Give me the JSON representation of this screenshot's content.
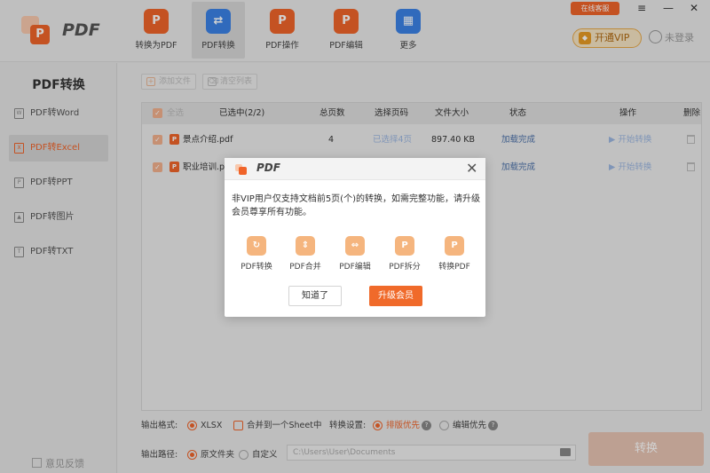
{
  "app": {
    "title": "PDF"
  },
  "toolbar": {
    "tabs": [
      {
        "label": "转换为PDF",
        "icon": "convert-to-pdf-icon"
      },
      {
        "label": "PDF转换",
        "icon": "pdf-convert-icon"
      },
      {
        "label": "PDF操作",
        "icon": "pdf-operate-icon"
      },
      {
        "label": "PDF编辑",
        "icon": "pdf-edit-icon"
      },
      {
        "label": "更多",
        "icon": "more-grid-icon"
      }
    ],
    "service_label": "在线客服",
    "vip_label": "开通VIP",
    "login_label": "未登录"
  },
  "sidebar": {
    "title": "PDF转换",
    "items": [
      {
        "label": "PDF转Word",
        "icon": "W"
      },
      {
        "label": "PDF转Excel",
        "icon": "X"
      },
      {
        "label": "PDF转PPT",
        "icon": "P"
      },
      {
        "label": "PDF转图片",
        "icon": "▲"
      },
      {
        "label": "PDF转TXT",
        "icon": "T"
      }
    ],
    "feedback_label": "意见反馈"
  },
  "main": {
    "add_file_label": "添加文件",
    "clear_list_label": "清空列表",
    "table": {
      "headers": {
        "select_all": "全选",
        "selected": "已选中(2/2)",
        "pages": "总页数",
        "select_pages": "选择页码",
        "size": "文件大小",
        "status": "状态",
        "action": "操作",
        "delete": "删除"
      },
      "rows": [
        {
          "name": "景点介绍.pdf",
          "pages": "4",
          "select_pages": "已选择4页",
          "size": "897.40 KB",
          "status": "加载完成",
          "action": "开始转换"
        },
        {
          "name": "职业培训.pd",
          "pages": "",
          "select_pages": "",
          "size": "",
          "status": "加载完成",
          "action": "开始转换"
        }
      ]
    },
    "output": {
      "format_label": "输出格式:",
      "format_value": "XLSX",
      "merge_label": "合并到一个Sheet中",
      "setting_label": "转换设置:",
      "option1": "排版优先",
      "option2": "编辑优先",
      "path_label": "输出路径:",
      "path_option1": "原文件夹",
      "path_option2": "自定义",
      "path_value": "C:\\Users\\User\\Documents"
    },
    "start_label": "转换"
  },
  "dialog": {
    "title": "PDF",
    "message": "非VIP用户仅支持文档前5页(个)的转换，如需完整功能，请升级会员尊享所有功能。",
    "features": [
      {
        "label": "PDF转换",
        "icon": "refresh-icon"
      },
      {
        "label": "PDF合并",
        "icon": "merge-icon"
      },
      {
        "label": "PDF编辑",
        "icon": "edit-icon"
      },
      {
        "label": "PDF拆分",
        "icon": "split-icon"
      },
      {
        "label": "转换PDF",
        "icon": "to-pdf-icon"
      }
    ],
    "know_label": "知道了",
    "upgrade_label": "升级会员"
  },
  "colors": {
    "accent": "#f0642a",
    "link": "#4a6fa8",
    "vip": "#e79b25"
  }
}
